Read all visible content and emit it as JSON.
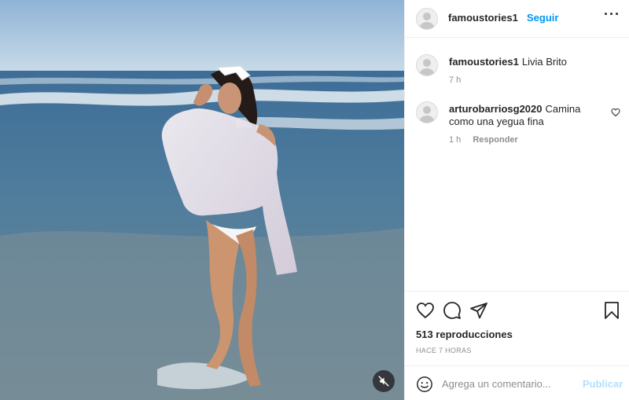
{
  "post": {
    "author": "famoustories1",
    "follow_label": "Seguir",
    "more_label": "···",
    "caption": {
      "username": "famoustories1",
      "text": "Livia Brito",
      "time": "7 h"
    },
    "comments": [
      {
        "username": "arturobarriosg2020",
        "text": "Camina como una yegua fina",
        "time": "1 h",
        "reply_label": "Responder"
      }
    ],
    "views_text": "513 reproducciones",
    "time_ago": "HACE 7 HORAS",
    "add_comment": {
      "placeholder": "Agrega un comentario...",
      "publish_label": "Publicar"
    }
  },
  "icons": {
    "like": "heart-icon",
    "comment": "comment-bubble-icon",
    "share": "paper-plane-icon",
    "save": "bookmark-icon",
    "emoji": "smiley-icon",
    "mute": "muted-speaker-icon",
    "comment_like": "heart-icon"
  },
  "colors": {
    "link_blue": "#0095f6",
    "publish_disabled": "#b2dffc",
    "muted_text": "#8e8e8e",
    "border": "#efefef"
  }
}
